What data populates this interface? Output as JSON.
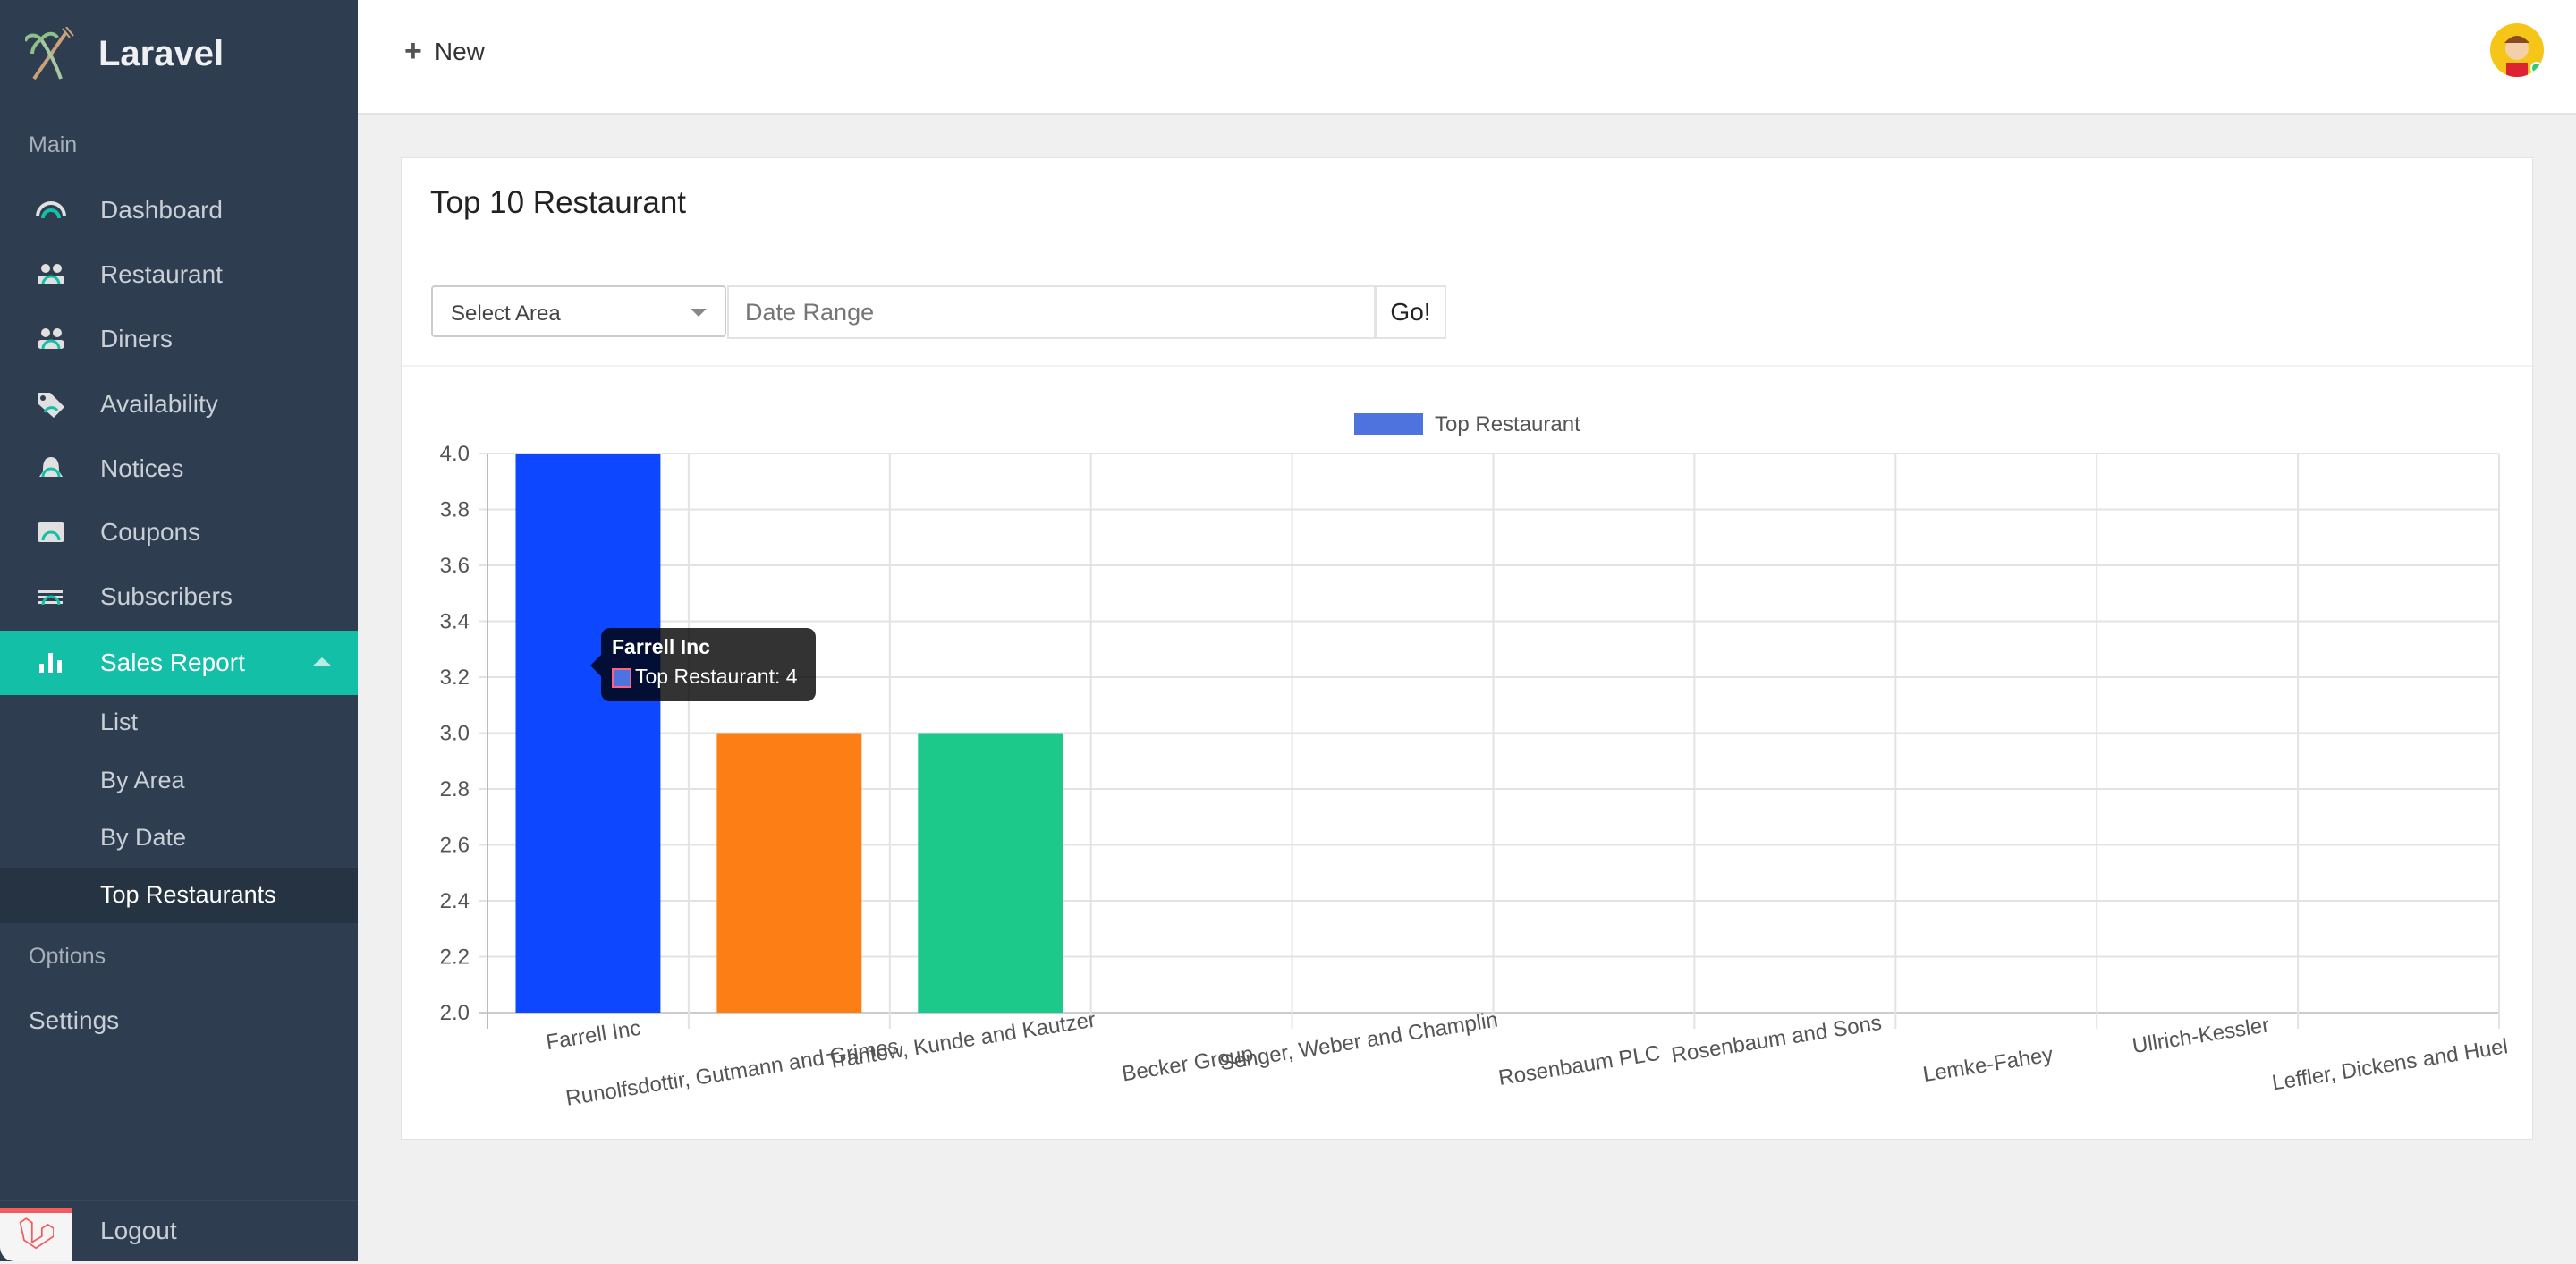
{
  "sidebar": {
    "brand": "Laravel",
    "section_main": "Main",
    "items": [
      {
        "label": "Dashboard",
        "icon": "dashboard-gauge-icon"
      },
      {
        "label": "Restaurant",
        "icon": "users-icon"
      },
      {
        "label": "Diners",
        "icon": "users-icon"
      },
      {
        "label": "Availability",
        "icon": "tag-icon"
      },
      {
        "label": "Notices",
        "icon": "bell-icon"
      },
      {
        "label": "Coupons",
        "icon": "ticket-icon"
      },
      {
        "label": "Subscribers",
        "icon": "list-icon"
      },
      {
        "label": "Sales Report",
        "icon": "chart-icon"
      }
    ],
    "sub_items": [
      "List",
      "By Area",
      "By Date",
      "Top Restaurants"
    ],
    "section_options": "Options",
    "settings": "Settings",
    "logout": "Logout"
  },
  "header": {
    "new_label": "New"
  },
  "card": {
    "title": "Top 10 Restaurant",
    "area_select": "Select Area",
    "date_placeholder": "Date Range",
    "go_label": "Go!"
  },
  "colors": {
    "sidebar": "#2e3d4f",
    "accent": "#13bfa6"
  },
  "tooltip": {
    "title": "Farrell Inc",
    "body": "Top Restaurant: 4"
  },
  "chart_data": {
    "type": "bar",
    "legend": "Top Restaurant",
    "legend_position": "top",
    "legend_color": "#4e73df",
    "categories": [
      "Farrell Inc",
      "Runolfsdottir, Gutmann and Grimes",
      "Trantow, Kunde and Kautzer",
      "Becker Group",
      "Senger, Weber and Champlin",
      "Rosenbaum PLC",
      "Rosenbaum and Sons",
      "Lemke-Fahey",
      "Ullrich-Kessler",
      "Leffler, Dickens and Huel"
    ],
    "values": [
      4,
      3,
      3,
      2,
      2,
      2,
      2,
      2,
      2,
      2
    ],
    "bar_colors": [
      "#0d47ff",
      "#fd7e14",
      "#1cc88a"
    ],
    "ylim": [
      2.0,
      4.0
    ],
    "yticks": [
      "2.0",
      "2.2",
      "2.4",
      "2.6",
      "2.8",
      "3.0",
      "3.2",
      "3.4",
      "3.6",
      "3.8",
      "4.0"
    ],
    "grid": true
  }
}
